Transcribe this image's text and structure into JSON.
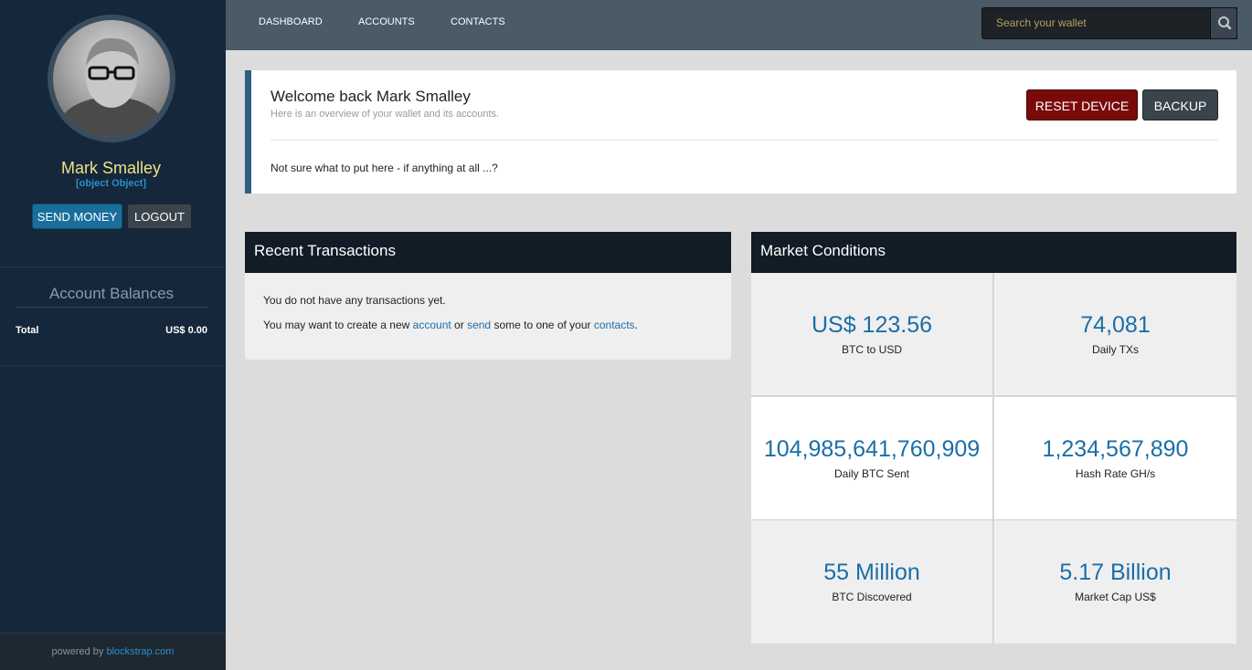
{
  "sidebar": {
    "user_name": "Mark Smalley",
    "user_sub": "[object Object]",
    "send_label": "SEND MONEY",
    "logout_label": "LOGOUT",
    "balances_title": "Account Balances",
    "total_label": "Total",
    "total_value": "US$ 0.00",
    "footer_prefix": "powered by",
    "footer_link": "blockstrap.com"
  },
  "nav": {
    "items": [
      "DASHBOARD",
      "ACCOUNTS",
      "CONTACTS"
    ],
    "search_placeholder": "Search your wallet"
  },
  "welcome": {
    "title": "Welcome back Mark Smalley",
    "subtitle": "Here is an overview of your wallet and its accounts.",
    "reset_label": "RESET DEVICE",
    "backup_label": "BACKUP",
    "note": "Not sure what to put here - if anything at all ...?"
  },
  "transactions": {
    "title": "Recent Transactions",
    "line1": "You do not have any transactions yet.",
    "line2_a": "You may want to create a new",
    "link_account": "account",
    "line2_b": "or",
    "link_send": "send",
    "line2_c": "some to one of your",
    "link_contacts": "contacts",
    "line2_d": "."
  },
  "market": {
    "title": "Market Conditions",
    "cells": [
      {
        "value": "US$ 123.56",
        "label": "BTC to USD"
      },
      {
        "value": "74,081",
        "label": "Daily TXs"
      },
      {
        "value": "104,985,641,760,909",
        "label": "Daily BTC Sent"
      },
      {
        "value": "1,234,567,890",
        "label": "Hash Rate GH/s"
      },
      {
        "value": "55 Million",
        "label": "BTC Discovered"
      },
      {
        "value": "5.17 Billion",
        "label": "Market Cap US$"
      }
    ]
  },
  "colors": {
    "sidebar_bg": "#15273a",
    "accent_blue": "#1a6ea8",
    "reset_red": "#7a0a0a",
    "name_yellow": "#f0e08a"
  }
}
